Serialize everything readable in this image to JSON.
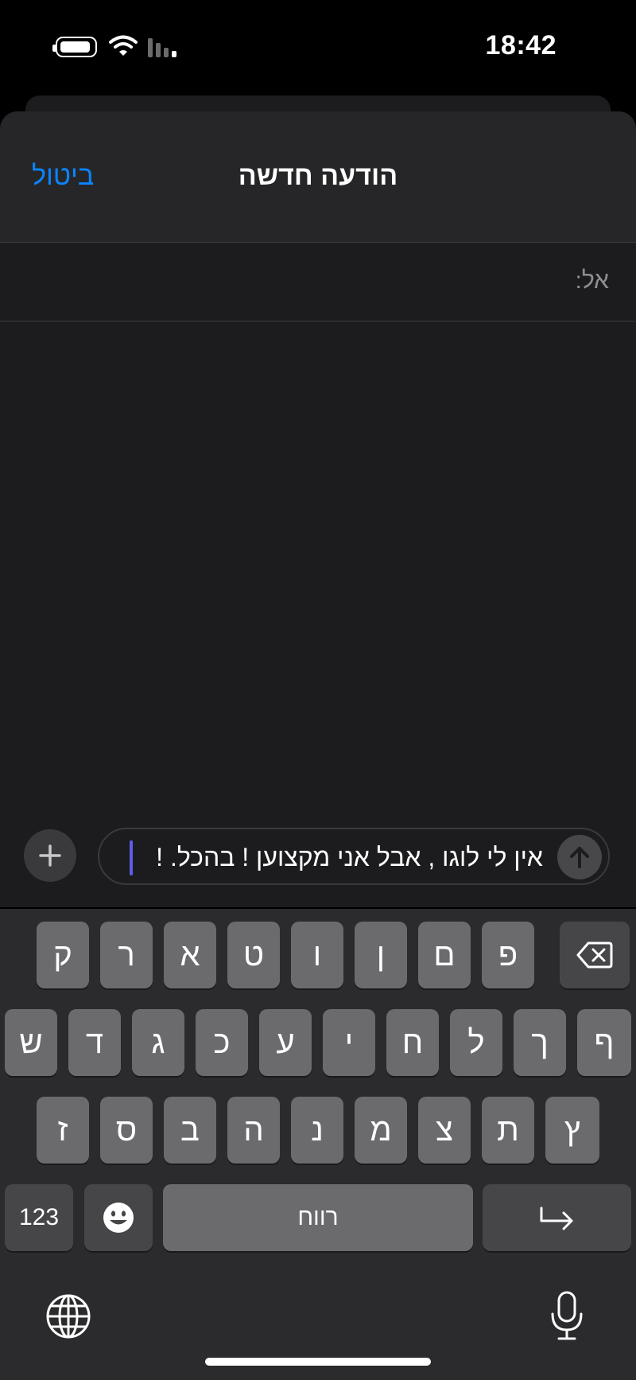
{
  "status_bar": {
    "time": "18:42"
  },
  "header": {
    "cancel_label": "ביטול",
    "title": "הודעה חדשה"
  },
  "recipient": {
    "label": "אל:"
  },
  "compose": {
    "message_text": "אין לי לוגו , אבל אני מקצוען ! בהכל.  !",
    "plus_icon": "plus-icon",
    "send_icon": "arrow-up-icon"
  },
  "keyboard": {
    "row1": [
      "ק",
      "ר",
      "א",
      "ט",
      "ו",
      "ן",
      "ם",
      "פ"
    ],
    "row2": [
      "ש",
      "ד",
      "ג",
      "כ",
      "ע",
      "י",
      "ח",
      "ל",
      "ך",
      "ף"
    ],
    "row3": [
      "ז",
      "ס",
      "ב",
      "ה",
      "נ",
      "מ",
      "צ",
      "ת",
      "ץ"
    ],
    "numbers_label": "123",
    "space_label": "רווח",
    "icons": {
      "delete": "delete-icon",
      "emoji": "emoji-icon",
      "return": "return-icon",
      "globe": "globe-icon",
      "mic": "microphone-icon"
    }
  },
  "colors": {
    "accent": "#0a84ff",
    "caret": "#5e5ce6",
    "background": "#1c1c1e",
    "key": "#6b6b6e",
    "key_dark": "#464649"
  }
}
